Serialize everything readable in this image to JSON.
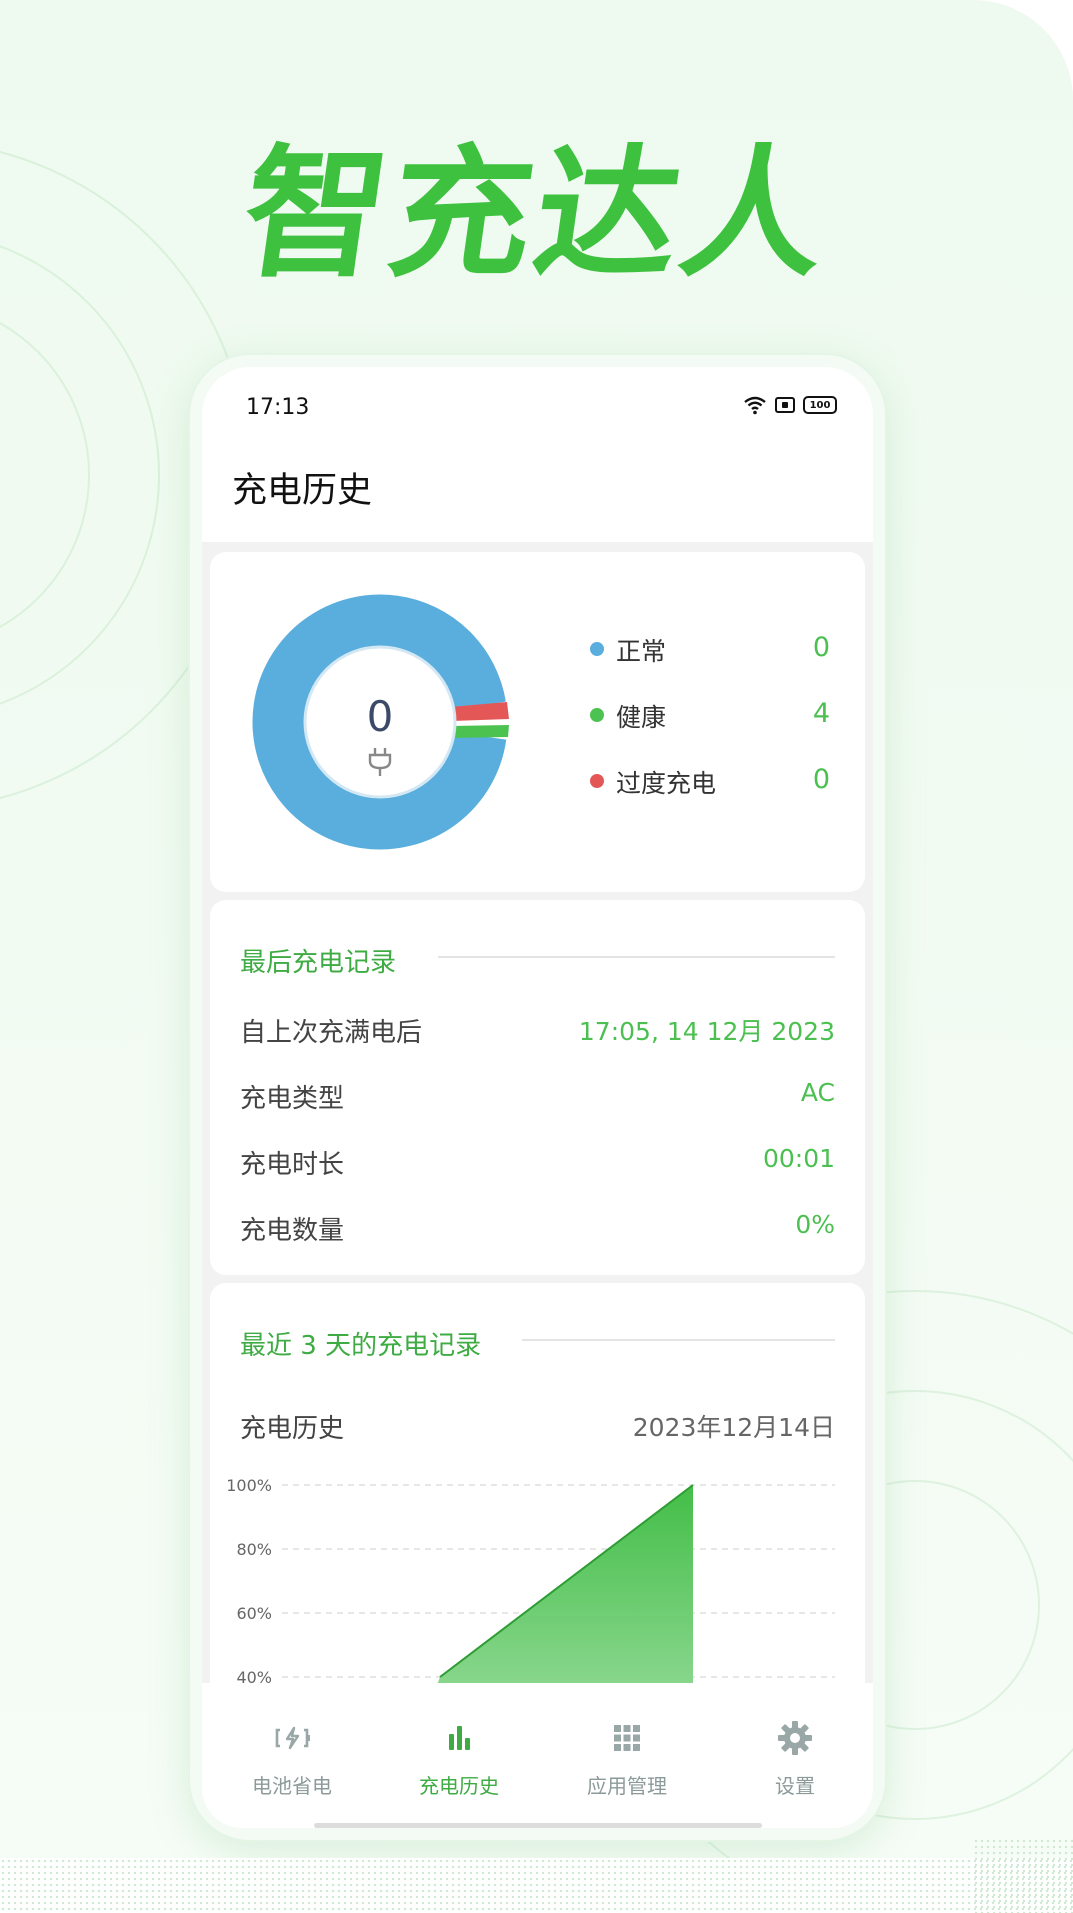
{
  "headline": "智充达人",
  "status_bar": {
    "time": "17:13",
    "battery": "100"
  },
  "page": {
    "title": "充电历史"
  },
  "summary": {
    "center_value": "0",
    "legend": [
      {
        "label": "正常",
        "value": "0",
        "color": "#5aaedd"
      },
      {
        "label": "健康",
        "value": "4",
        "color": "#4cc251"
      },
      {
        "label": "过度充电",
        "value": "0",
        "color": "#e45757"
      }
    ]
  },
  "last_charge": {
    "title": "最后充电记录",
    "rows": [
      {
        "label": "自上次充满电后",
        "value": "17:05, 14 12月 2023"
      },
      {
        "label": "充电类型",
        "value": "AC"
      },
      {
        "label": "充电时长",
        "value": "00:01"
      },
      {
        "label": "充电数量",
        "value": "0%"
      }
    ]
  },
  "recent": {
    "title": "最近 3 天的充电记录",
    "history_label": "充电历史",
    "date": "2023年12月14日"
  },
  "chart_data": {
    "type": "area",
    "y_ticks": [
      "100%",
      "80%",
      "60%",
      "40%"
    ],
    "ylim": [
      40,
      100
    ],
    "series": [
      {
        "values": [
          40,
          100
        ]
      }
    ],
    "color": "#4cc251",
    "grid": true
  },
  "nav": [
    {
      "label": "电池省电",
      "icon": "battery-charging-icon",
      "active": false
    },
    {
      "label": "充电历史",
      "icon": "bar-chart-icon",
      "active": true
    },
    {
      "label": "应用管理",
      "icon": "grid-apps-icon",
      "active": false
    },
    {
      "label": "设置",
      "icon": "gear-icon",
      "active": false
    }
  ],
  "colors": {
    "accent": "#3eab43",
    "donut_blue": "#5aaedd",
    "donut_red": "#e45757",
    "donut_green": "#4cc251"
  }
}
